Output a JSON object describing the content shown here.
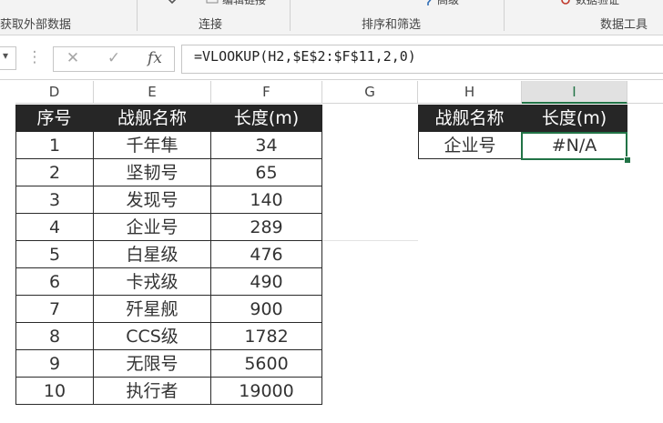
{
  "ribbon": {
    "top_fragments": [
      "编辑链接",
      "高级",
      "数据验证"
    ],
    "groups": [
      "获取外部数据",
      "连接",
      "排序和筛选",
      "数据工具"
    ]
  },
  "formula_bar": {
    "name_box_arrow": "▾",
    "more_icon": "⋮",
    "cancel_icon": "✕",
    "enter_icon": "✓",
    "fx_label": "fx",
    "formula": "=VLOOKUP(H2,$E$2:$F$11,2,0)"
  },
  "columns": [
    "D",
    "E",
    "F",
    "G",
    "H",
    "I"
  ],
  "table1": {
    "headers": [
      "序号",
      "战舰名称",
      "长度(m)"
    ],
    "rows": [
      [
        "1",
        "千年隼",
        "34"
      ],
      [
        "2",
        "坚韧号",
        "65"
      ],
      [
        "3",
        "发现号",
        "140"
      ],
      [
        "4",
        "企业号",
        "289"
      ],
      [
        "5",
        "白星级",
        "476"
      ],
      [
        "6",
        "卡戎级",
        "490"
      ],
      [
        "7",
        "歼星舰",
        "900"
      ],
      [
        "8",
        "CCS级",
        "1782"
      ],
      [
        "9",
        "无限号",
        "5600"
      ],
      [
        "10",
        "执行者",
        "19000"
      ]
    ]
  },
  "table2": {
    "headers": [
      "战舰名称",
      "长度(m)"
    ],
    "row": [
      "企业号",
      "#N/A"
    ]
  },
  "colors": {
    "header_bg": "#262626",
    "header_text": "#ffffff",
    "selection": "#217346"
  }
}
